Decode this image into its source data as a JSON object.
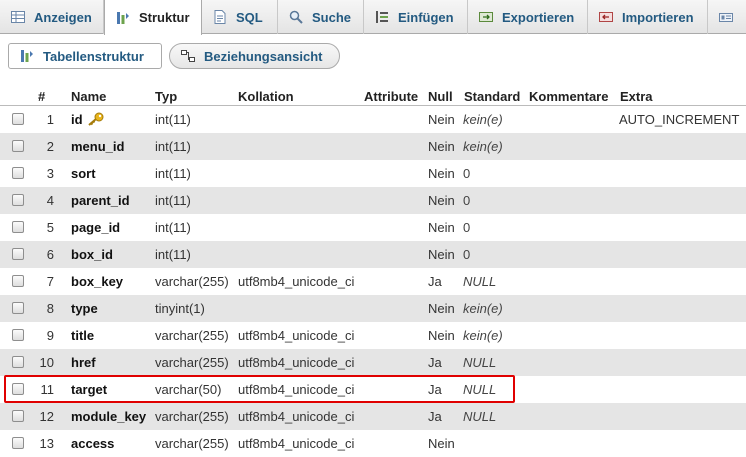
{
  "tabs": [
    {
      "label": "Anzeigen",
      "icon": "browse-icon"
    },
    {
      "label": "Struktur",
      "icon": "structure-icon",
      "active": true
    },
    {
      "label": "SQL",
      "icon": "sql-icon"
    },
    {
      "label": "Suche",
      "icon": "search-icon"
    },
    {
      "label": "Einfügen",
      "icon": "insert-icon"
    },
    {
      "label": "Exportieren",
      "icon": "export-icon"
    },
    {
      "label": "Importieren",
      "icon": "import-icon"
    },
    {
      "label": "",
      "icon": "more-icon"
    }
  ],
  "subnav": {
    "table_structure": "Tabellenstruktur",
    "relation_view": "Beziehungsansicht"
  },
  "table": {
    "headers": {
      "num": "#",
      "name": "Name",
      "type": "Typ",
      "collation": "Kollation",
      "attributes": "Attribute",
      "null": "Null",
      "default": "Standard",
      "comments": "Kommentare",
      "extra": "Extra"
    },
    "rows": [
      {
        "num": "1",
        "name": "id",
        "type": "int(11)",
        "collation": "",
        "null": "Nein",
        "default": "kein(e)",
        "extra": "AUTO_INCREMENT",
        "primary_key": true
      },
      {
        "num": "2",
        "name": "menu_id",
        "type": "int(11)",
        "collation": "",
        "null": "Nein",
        "default": "kein(e)",
        "extra": ""
      },
      {
        "num": "3",
        "name": "sort",
        "type": "int(11)",
        "collation": "",
        "null": "Nein",
        "default": "0",
        "extra": ""
      },
      {
        "num": "4",
        "name": "parent_id",
        "type": "int(11)",
        "collation": "",
        "null": "Nein",
        "default": "0",
        "extra": ""
      },
      {
        "num": "5",
        "name": "page_id",
        "type": "int(11)",
        "collation": "",
        "null": "Nein",
        "default": "0",
        "extra": ""
      },
      {
        "num": "6",
        "name": "box_id",
        "type": "int(11)",
        "collation": "",
        "null": "Nein",
        "default": "0",
        "extra": ""
      },
      {
        "num": "7",
        "name": "box_key",
        "type": "varchar(255)",
        "collation": "utf8mb4_unicode_ci",
        "null": "Ja",
        "default": "NULL",
        "extra": ""
      },
      {
        "num": "8",
        "name": "type",
        "type": "tinyint(1)",
        "collation": "",
        "null": "Nein",
        "default": "kein(e)",
        "extra": ""
      },
      {
        "num": "9",
        "name": "title",
        "type": "varchar(255)",
        "collation": "utf8mb4_unicode_ci",
        "null": "Nein",
        "default": "kein(e)",
        "extra": ""
      },
      {
        "num": "10",
        "name": "href",
        "type": "varchar(255)",
        "collation": "utf8mb4_unicode_ci",
        "null": "Ja",
        "default": "NULL",
        "extra": ""
      },
      {
        "num": "11",
        "name": "target",
        "type": "varchar(50)",
        "collation": "utf8mb4_unicode_ci",
        "null": "Ja",
        "default": "NULL",
        "extra": "",
        "highlighted": true
      },
      {
        "num": "12",
        "name": "module_key",
        "type": "varchar(255)",
        "collation": "utf8mb4_unicode_ci",
        "null": "Ja",
        "default": "NULL",
        "extra": ""
      },
      {
        "num": "13",
        "name": "access",
        "type": "varchar(255)",
        "collation": "utf8mb4_unicode_ci",
        "null": "Nein",
        "default": "",
        "extra": ""
      }
    ]
  },
  "colors": {
    "link": "#235a81",
    "row_alt": "#e5e5e5",
    "highlight_border": "#e00000",
    "key_icon": "#e8b51c"
  }
}
